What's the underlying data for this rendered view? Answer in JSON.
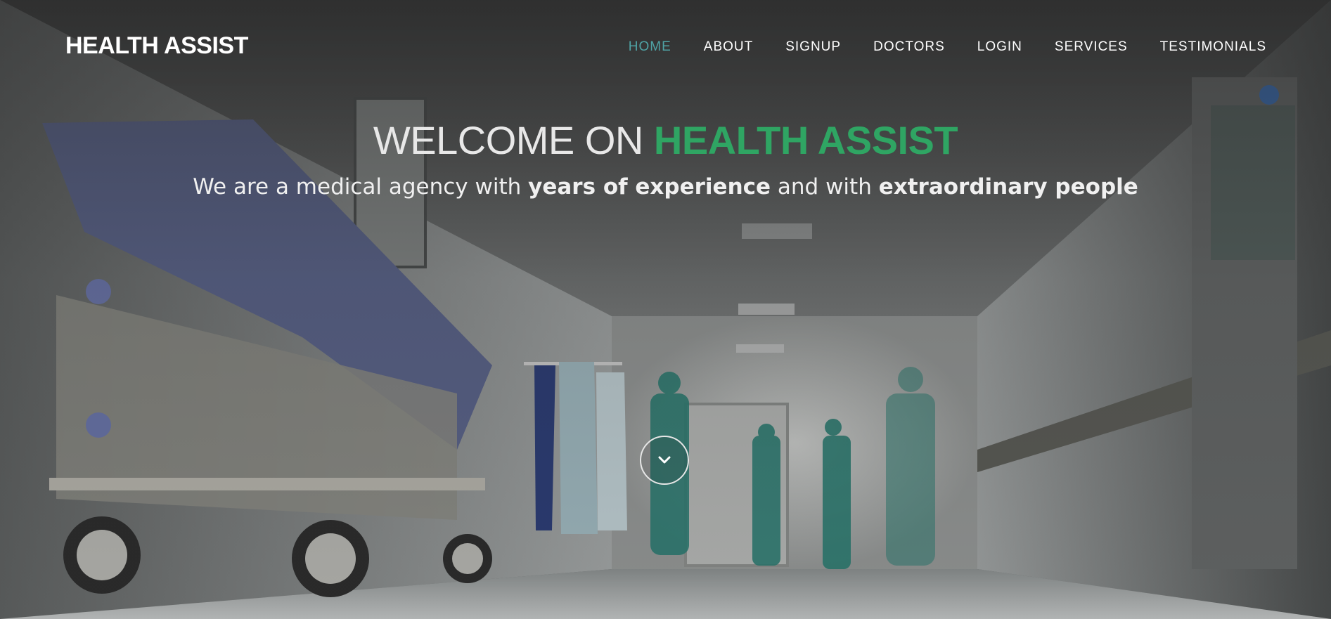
{
  "brand": {
    "name": "HEALTH ASSIST"
  },
  "nav": {
    "items": [
      {
        "label": "HOME",
        "active": true
      },
      {
        "label": "ABOUT",
        "active": false
      },
      {
        "label": "SIGNUP",
        "active": false
      },
      {
        "label": "DOCTORS",
        "active": false
      },
      {
        "label": "LOGIN",
        "active": false
      },
      {
        "label": "SERVICES",
        "active": false
      },
      {
        "label": "TESTIMONIALS",
        "active": false
      }
    ],
    "active_color": "#4fa3a5"
  },
  "hero": {
    "headline_prefix": "WELCOME ON ",
    "headline_accent": "HEALTH ASSIST",
    "accent_color": "#2fa563",
    "subline_part1": "We are a medical agency with ",
    "subline_bold1": "years of experience",
    "subline_part2": " and with ",
    "subline_bold2": "extraordinary people",
    "scroll_icon": "chevron-down-icon",
    "background_image": "hospital-corridor-photo"
  }
}
